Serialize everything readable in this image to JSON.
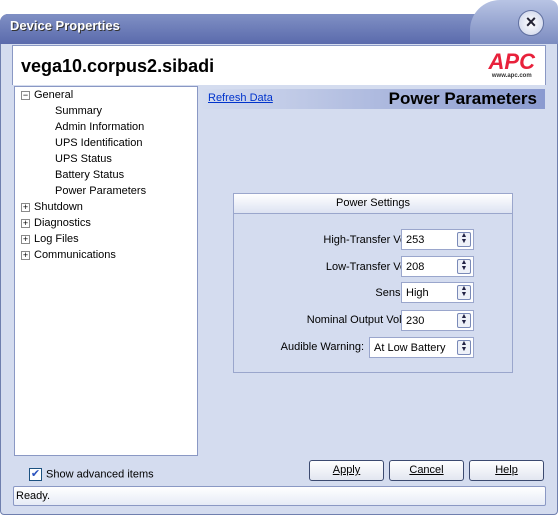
{
  "window": {
    "title": "Device Properties"
  },
  "header": {
    "hostname": "vega10.corpus2.sibadi",
    "logo": "APC",
    "logo_url": "www.apc.com"
  },
  "tree": {
    "items": [
      {
        "label": "General",
        "expander": "−"
      },
      {
        "label": "Summary"
      },
      {
        "label": "Admin Information"
      },
      {
        "label": "UPS Identification"
      },
      {
        "label": "UPS Status"
      },
      {
        "label": "Battery Status"
      },
      {
        "label": "Power Parameters"
      },
      {
        "label": "Shutdown",
        "expander": "+"
      },
      {
        "label": "Diagnostics",
        "expander": "+"
      },
      {
        "label": "Log Files",
        "expander": "+"
      },
      {
        "label": "Communications",
        "expander": "+"
      }
    ]
  },
  "panel": {
    "refresh": "Refresh Data",
    "title": "Power Parameters"
  },
  "settings": {
    "title": "Power Settings",
    "fields": [
      {
        "label": "High-Transfer Voltage",
        "value": "253"
      },
      {
        "label": "Low-Transfer Voltage",
        "value": "208"
      },
      {
        "label": "Sensitivity:",
        "value": "High"
      },
      {
        "label": "Nominal Output Voltage:",
        "value": "230"
      },
      {
        "label": "Audible Warning:",
        "value": "At Low Battery"
      }
    ]
  },
  "footer": {
    "show_advanced": "Show advanced items",
    "show_advanced_checked": true,
    "apply": "Apply",
    "cancel": "Cancel",
    "help": "Help",
    "status": "Ready."
  }
}
